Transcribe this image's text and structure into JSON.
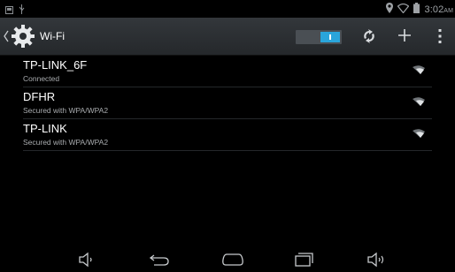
{
  "status": {
    "time": "3:02",
    "ampm": "AM"
  },
  "actionbar": {
    "title": "Wi-Fi",
    "wifi_enabled": true
  },
  "networks": [
    {
      "ssid": "TP-LINK_6F",
      "status": "Connected"
    },
    {
      "ssid": "DFHR",
      "status": "Secured with WPA/WPA2"
    },
    {
      "ssid": "TP-LINK",
      "status": "Secured with WPA/WPA2"
    }
  ],
  "icons": {
    "status_left": [
      "screenshot-icon",
      "usb-icon"
    ],
    "status_right": [
      "location-icon",
      "wifi-status-icon",
      "battery-icon"
    ],
    "actionbar": [
      "settings-gear-icon",
      "toggle-switch",
      "wps-icon",
      "add-network-icon",
      "overflow-menu-icon"
    ],
    "nav": [
      "volume-down-icon",
      "back-icon",
      "home-icon",
      "recent-apps-icon",
      "volume-up-icon"
    ]
  },
  "colors": {
    "accent": "#2aa5db",
    "actionbar": "#2e3236",
    "background": "#000000"
  }
}
